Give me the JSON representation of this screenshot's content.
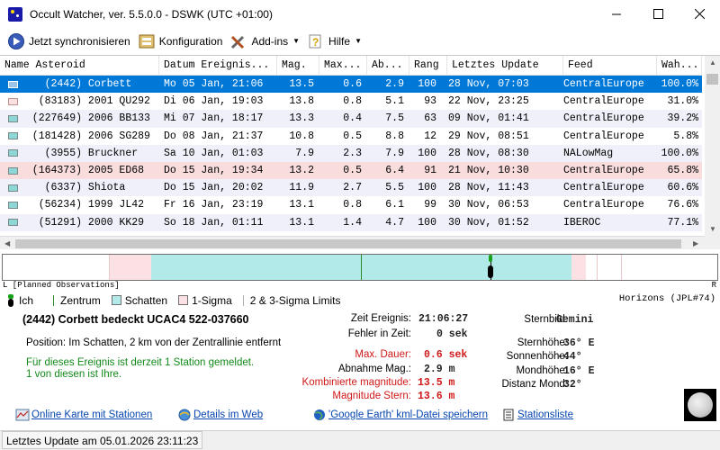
{
  "window": {
    "title": "Occult Watcher, ver. 5.5.0.0 - DSWK (UTC +01:00)",
    "minimize_icon": "minimize-icon",
    "maximize_icon": "maximize-icon",
    "close_icon": "close-icon"
  },
  "toolbar": {
    "sync_label": "Jetzt synchronisieren",
    "config_label": "Konfiguration",
    "addins_label": "Add-ins",
    "help_label": "Hilfe"
  },
  "table": {
    "headers": [
      "Name Asteroid",
      "Datum Ereignis...",
      "Mag.",
      "Max...",
      "Ab...",
      "Rang",
      "Letztes Update",
      "Feed",
      "Wah..."
    ],
    "rows": [
      {
        "name": "    (2442) Corbett",
        "date": "Mo 05 Jan, 21:06",
        "mag": "13.5",
        "max": "0.6",
        "ab": "2.9",
        "rank": "100",
        "updated": "28 Nov, 07:03",
        "feed": "CentralEurope",
        "prob": "100.0%",
        "style": "sel"
      },
      {
        "name": "   (83183) 2001 QU292",
        "date": "Di 06 Jan, 19:03",
        "mag": "13.8",
        "max": "0.8",
        "ab": "5.1",
        "rank": "93",
        "updated": "22 Nov, 23:25",
        "feed": "CentralEurope",
        "prob": "31.0%",
        "style": "plain",
        "swatch": "pink"
      },
      {
        "name": "  (227649) 2006 BB133",
        "date": "Mi 07 Jan, 18:17",
        "mag": "13.3",
        "max": "0.4",
        "ab": "7.5",
        "rank": "63",
        "updated": "09 Nov, 01:41",
        "feed": "CentralEurope",
        "prob": "39.2%",
        "style": "alt"
      },
      {
        "name": "  (181428) 2006 SG289",
        "date": "Do 08 Jan, 21:37",
        "mag": "10.8",
        "max": "0.5",
        "ab": "8.8",
        "rank": "12",
        "updated": "29 Nov, 08:51",
        "feed": "CentralEurope",
        "prob": "5.8%",
        "style": "plain"
      },
      {
        "name": "    (3955) Bruckner",
        "date": "Sa 10 Jan, 01:03",
        "mag": "7.9",
        "max": "2.3",
        "ab": "7.9",
        "rank": "100",
        "updated": "28 Nov, 08:30",
        "feed": "NALowMag",
        "prob": "100.0%",
        "style": "alt"
      },
      {
        "name": "  (164373) 2005 ED68",
        "date": "Do 15 Jan, 19:34",
        "mag": "13.2",
        "max": "0.5",
        "ab": "6.4",
        "rank": "91",
        "updated": "21 Nov, 10:30",
        "feed": "CentralEurope",
        "prob": "65.8%",
        "style": "pink"
      },
      {
        "name": "    (6337) Shiota",
        "date": "Do 15 Jan, 20:02",
        "mag": "11.9",
        "max": "2.7",
        "ab": "5.5",
        "rank": "100",
        "updated": "28 Nov, 11:43",
        "feed": "CentralEurope",
        "prob": "60.6%",
        "style": "alt"
      },
      {
        "name": "   (56234) 1999 JL42",
        "date": "Fr 16 Jan, 23:19",
        "mag": "13.1",
        "max": "0.8",
        "ab": "6.1",
        "rank": "99",
        "updated": "30 Nov, 06:53",
        "feed": "CentralEurope",
        "prob": "76.6%",
        "style": "plain"
      },
      {
        "name": "   (51291) 2000 KK29",
        "date": "So 18 Jan, 01:11",
        "mag": "13.1",
        "max": "1.4",
        "ab": "4.7",
        "rank": "100",
        "updated": "30 Nov, 01:52",
        "feed": "IBEROC",
        "prob": "77.1%",
        "style": "alt"
      }
    ]
  },
  "graph": {
    "caption": "L [Planned Observations]",
    "right_label": "R"
  },
  "legend": {
    "items": [
      "Ich",
      "Zentrum",
      "Schatten",
      "1-Sigma",
      "2 & 3-Sigma Limits"
    ],
    "source": "Horizons (JPL#74)",
    "colors": {
      "ich": "#18a018",
      "zentrum": "#2a8a2a",
      "schatten": "#b2eaea",
      "sigma1": "#fbe0e4",
      "sigma23": "#b0b0b0"
    }
  },
  "details": {
    "event_title": "(2442) Corbett bedeckt UCAC4 522-037660",
    "position": "Position:  Im Schatten, 2 km von der Zentrallinie entfernt",
    "station_msg_1": "Für dieses Ereignis ist derzeit 1 Station gemeldet.",
    "station_msg_2": "1 von diesen ist Ihre.",
    "event_time_label": "Zeit Ereignis:",
    "event_time_value": "21:06:27",
    "time_error_label": "Fehler in Zeit:",
    "time_error_value": "0 sek",
    "max_duration_label": "Max. Dauer:",
    "max_duration_value": "0.6 sek",
    "mag_drop_label": "Abnahme Mag.:",
    "mag_drop_value": "2.9 m",
    "combined_mag_label": "Kombinierte magnitude:",
    "combined_mag_value": "13.5 m",
    "star_mag_label": "Magnitude Stern:",
    "star_mag_value": "13.6 m",
    "constellation_label": "Sternbild:",
    "constellation_value": "Gemini",
    "star_alt_label": "Sternhöhe:",
    "star_alt_value": "36° E",
    "sun_alt_label": "Sonnenhöhe:",
    "sun_alt_value": "-44°",
    "moon_alt_label": "Mondhöhe:",
    "moon_alt_value": "16° E",
    "moon_dist_label": "Distanz Mond:",
    "moon_dist_value": "32°"
  },
  "links": {
    "map_label": "Online Karte mit Stationen",
    "web_label": "Details im Web",
    "kml_label": "'Google Earth' kml-Datei speichern",
    "stations_label": "Stationsliste"
  },
  "status": {
    "last_update": "Letztes Update am 05.01.2026 23:11:23"
  }
}
